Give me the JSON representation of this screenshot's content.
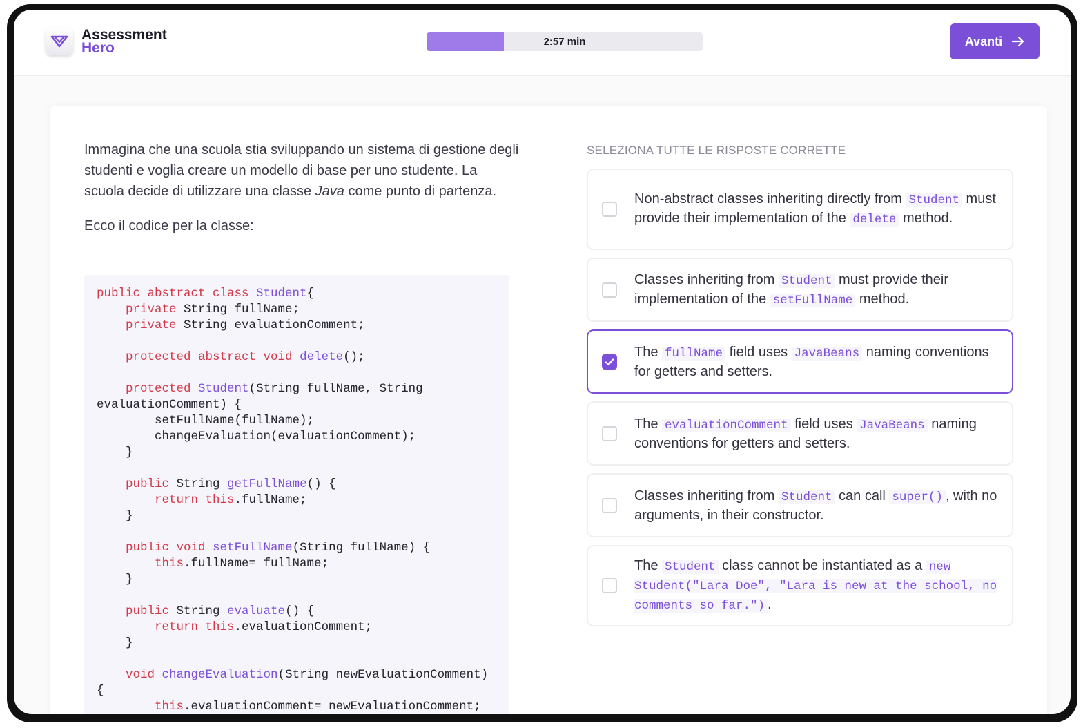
{
  "app": {
    "logo_line1": "Assessment",
    "logo_line2": "Hero",
    "accent_color": "#7c4fd8"
  },
  "timer": {
    "label": "2:57 min",
    "progress_fraction": 0.28
  },
  "toolbar": {
    "next_label": "Avanti",
    "next_icon": "arrow-right-icon"
  },
  "question": {
    "paragraph1_a": "Immagina che una scuola stia sviluppando un sistema di gestione degli studenti e voglia creare un modello di base per uno studente. La scuola decide di utilizzare una classe ",
    "paragraph1_em": "Java",
    "paragraph1_b": " come punto di partenza.",
    "paragraph2": "Ecco il codice per la classe:"
  },
  "code": {
    "l1_kw": "public abstract class ",
    "l1_fn": "Student",
    "l1_rest": "{",
    "l2_kw": "private",
    "l2_rest": " String fullName;",
    "l3_kw": "private",
    "l3_rest": " String evaluationComment;",
    "l4_kw": "protected abstract void ",
    "l4_fn": "delete",
    "l4_rest": "();",
    "l5_kw": "protected ",
    "l5_fn": "Student",
    "l5_rest": "(String fullName, String",
    "l6": "evaluationComment) {",
    "l7": "setFullName(fullName);",
    "l8": "changeEvaluation(evaluationComment);",
    "l9": "}",
    "l10_kw": "public",
    "l10_mid": " String ",
    "l10_fn": "getFullName",
    "l10_rest": "() {",
    "l11_kw": "return this",
    "l11_rest": ".fullName;",
    "l12": "}",
    "l13_kw": "public void ",
    "l13_fn": "setFullName",
    "l13_rest": "(String fullName) {",
    "l14_kw": "this",
    "l14_rest": ".fullName= fullName;",
    "l15": "}",
    "l16_kw": "public",
    "l16_mid": " String ",
    "l16_fn": "evaluate",
    "l16_rest": "() {",
    "l17_kw": "return this",
    "l17_rest": ".evaluationComment;",
    "l18": "}",
    "l19_kw": "void ",
    "l19_fn": "changeEvaluation",
    "l19_rest": "(String newEvaluationComment)",
    "l20": "{",
    "l21_kw": "this",
    "l21_rest": ".evaluationComment= newEvaluationComment;"
  },
  "answers": {
    "title": "SELEZIONA TUTTE LE RISPOSTE CORRETTE",
    "a1": {
      "t1": "Non-abstract classes inheriting directly from ",
      "c1": "Student",
      "t2": " must provide their implementation of the ",
      "c2": "delete",
      "t3": " method.",
      "checked": false
    },
    "a2": {
      "t1": "Classes inheriting from ",
      "c1": "Student",
      "t2": " must provide their implementation of the ",
      "c2": "setFullName",
      "t3": " method.",
      "checked": false
    },
    "a3": {
      "t1": "The ",
      "c1": "fullName",
      "t2": " field uses ",
      "c2": "JavaBeans",
      "t3": " naming conventions for getters and setters.",
      "checked": true
    },
    "a4": {
      "t1": "The ",
      "c1": "evaluationComment",
      "t2": " field uses ",
      "c2": "JavaBeans",
      "t3": " naming conventions for getters and setters.",
      "checked": false
    },
    "a5": {
      "t1": "Classes inheriting from ",
      "c1": "Student",
      "t2": " can call ",
      "c2": "super()",
      "t3": ", with no arguments, in their constructor.",
      "checked": false
    },
    "a6": {
      "t1": "The ",
      "c1": "Student",
      "t2": " class cannot be instantiated as a ",
      "c2": "new Student(\"Lara Doe\", \"Lara is new at the school, no comments so far.\")",
      "t3": ".",
      "checked": false
    }
  }
}
